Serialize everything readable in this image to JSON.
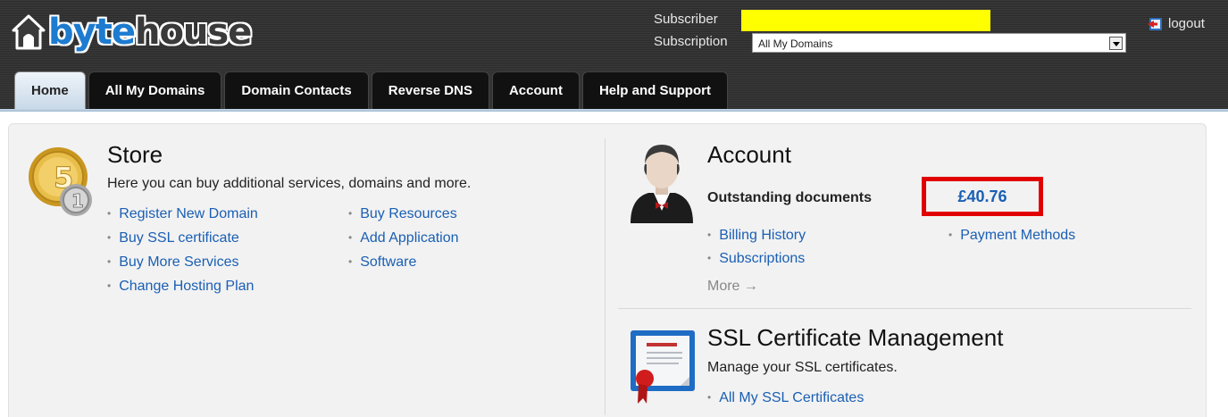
{
  "brand": {
    "logo_text_byte": "byte",
    "logo_text_house": "house",
    "byte_color": "#1d7bd0"
  },
  "header": {
    "subscriber_label": "Subscriber",
    "subscriber_value": "",
    "subscriber_highlight": "#ffff00",
    "subscription_label": "Subscription",
    "subscription_value": "All My Domains",
    "logout_label": "logout"
  },
  "tabs": [
    {
      "label": "Home",
      "active": true
    },
    {
      "label": "All My Domains"
    },
    {
      "label": "Domain Contacts"
    },
    {
      "label": "Reverse DNS"
    },
    {
      "label": "Account"
    },
    {
      "label": "Help and Support"
    }
  ],
  "store": {
    "title": "Store",
    "description": "Here you can buy additional services, domains and more.",
    "links_col1": [
      "Register New Domain",
      "Buy SSL certificate",
      "Buy More Services",
      "Change Hosting Plan"
    ],
    "links_col2": [
      "Buy Resources",
      "Add Application",
      "Software"
    ]
  },
  "account": {
    "title": "Account",
    "outstanding_label": "Outstanding documents",
    "outstanding_amount": "£40.76",
    "highlight_color": "#e10000",
    "links_col1": [
      "Billing History",
      "Subscriptions"
    ],
    "links_col2": [
      "Payment Methods"
    ],
    "more_label": "More →"
  },
  "ssl": {
    "title": "SSL Certificate Management",
    "description": "Manage your SSL certificates.",
    "links": [
      "All My SSL Certificates"
    ]
  },
  "colors": {
    "link": "#1a5fb4",
    "tab_bg": "#111111",
    "tab_active_bg": "#dde8f2"
  }
}
